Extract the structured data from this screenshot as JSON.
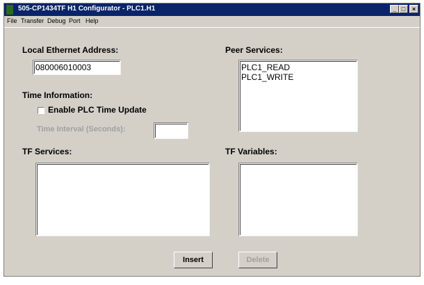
{
  "window": {
    "title": "505-CP1434TF H1 Configurator - PLC1.H1",
    "min_glyph": "_",
    "max_glyph": "□",
    "close_glyph": "×"
  },
  "menu": [
    "File",
    "Transfer",
    "Debug",
    "Port",
    "Help"
  ],
  "local_ethernet": {
    "label": "Local Ethernet Address:",
    "value": "080006010003"
  },
  "time_info": {
    "label": "Time Information:",
    "enable_label": "Enable PLC Time Update",
    "enable_checked": false,
    "interval_label": "Time Interval (Seconds):",
    "interval_value": ""
  },
  "peer_services": {
    "label": "Peer Services:",
    "items": [
      "PLC1_READ",
      "PLC1_WRITE"
    ]
  },
  "tf_services": {
    "label": "TF Services:",
    "items": []
  },
  "tf_variables": {
    "label": "TF Variables:",
    "items": []
  },
  "buttons": {
    "insert": "Insert",
    "delete": "Delete"
  }
}
